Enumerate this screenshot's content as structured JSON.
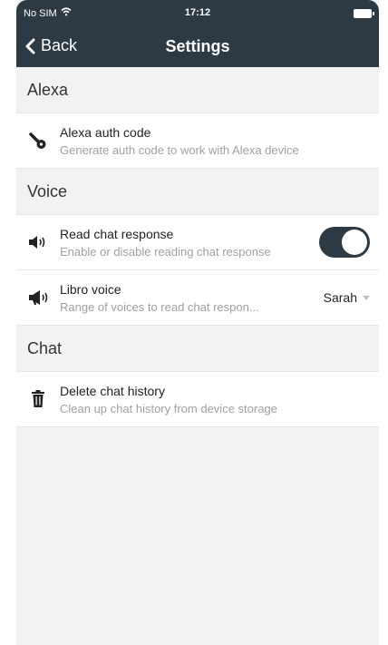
{
  "status_bar": {
    "carrier": "No SIM",
    "time": "17:12"
  },
  "nav": {
    "back_label": "Back",
    "title": "Settings"
  },
  "sections": {
    "alexa": {
      "header": "Alexa",
      "auth_code": {
        "title": "Alexa auth code",
        "subtitle": "Generate auth code to work with Alexa device",
        "icon": "key-icon"
      }
    },
    "voice": {
      "header": "Voice",
      "read_chat": {
        "title": "Read chat response",
        "subtitle": "Enable or disable reading chat response",
        "icon": "speaker-icon",
        "toggle_on": true
      },
      "libro_voice": {
        "title": "Libro voice",
        "subtitle": "Range of voices to read chat respon...",
        "icon": "megaphone-icon",
        "selected": "Sarah"
      }
    },
    "chat": {
      "header": "Chat",
      "delete_history": {
        "title": "Delete chat history",
        "subtitle": "Clean up chat history from device storage",
        "icon": "trash-icon"
      }
    }
  },
  "colors": {
    "header_bg": "#2d3a44",
    "list_bg": "#ffffff",
    "screen_bg": "#f2f2f2",
    "toggle_on": "#2d3a44"
  }
}
